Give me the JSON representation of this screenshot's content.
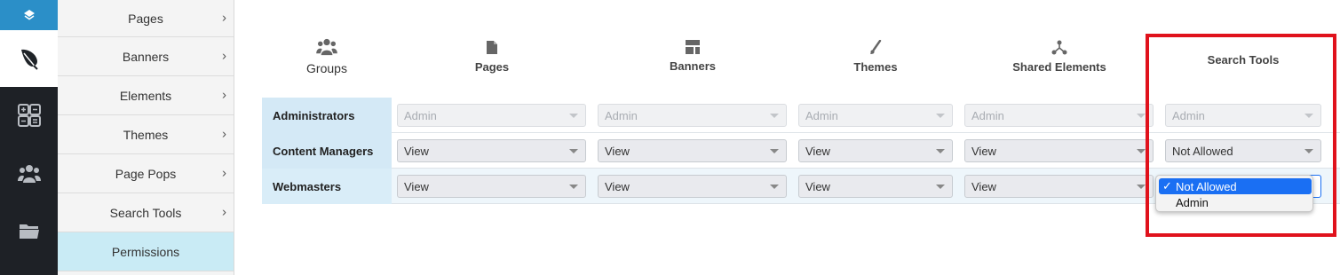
{
  "submenu": {
    "items": [
      {
        "label": "Pages"
      },
      {
        "label": "Banners"
      },
      {
        "label": "Elements"
      },
      {
        "label": "Themes"
      },
      {
        "label": "Page Pops"
      },
      {
        "label": "Search Tools"
      },
      {
        "label": "Permissions",
        "active": true
      }
    ]
  },
  "columns": {
    "groups": "Groups",
    "pages": "Pages",
    "banners": "Banners",
    "themes": "Themes",
    "shared": "Shared Elements",
    "search_tools": "Search Tools"
  },
  "rows": [
    {
      "label": "Administrators",
      "pages": "Admin",
      "banners": "Admin",
      "themes": "Admin",
      "shared": "Admin",
      "search_tools": "Admin"
    },
    {
      "label": "Content Managers",
      "pages": "View",
      "banners": "View",
      "themes": "View",
      "shared": "View",
      "search_tools": "Not Allowed"
    },
    {
      "label": "Webmasters",
      "pages": "View",
      "banners": "View",
      "themes": "View",
      "shared": "View",
      "search_tools": ""
    }
  ],
  "dropdown": {
    "options": [
      "Not Allowed",
      "Admin"
    ],
    "selected": "Not Allowed",
    "check": "✓"
  },
  "colors": {
    "accent": "#2b8fc8",
    "highlight": "#e0121c",
    "selected_option": "#1a6ff3"
  },
  "icons": {
    "rail": [
      "layers-icon",
      "feather-icon",
      "calculator-icon",
      "users-icon",
      "folder-icon"
    ],
    "columns": [
      "users-icon",
      "file-icon",
      "layout-icon",
      "brush-icon",
      "share-icon"
    ]
  }
}
